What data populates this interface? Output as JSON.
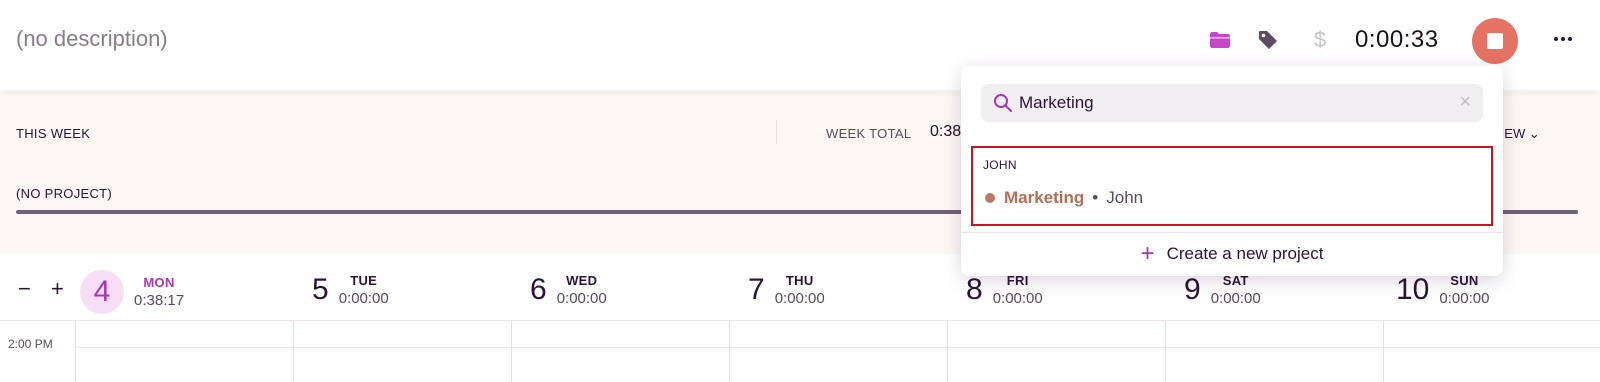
{
  "timer": {
    "description": "(no description)",
    "elapsed": "0:00:33",
    "icons": [
      "folder-icon",
      "tag-icon",
      "dollar-icon",
      "stop-icon",
      "more-icon"
    ],
    "colors": {
      "accent": "#a736b6",
      "stop": "#e57262",
      "folder": "#c548c9"
    }
  },
  "summary": {
    "this_week": "THIS WEEK",
    "week_total_label": "WEEK TOTAL",
    "week_total_value": "0:38",
    "view_label": "VIEW",
    "no_project": "(NO PROJECT)"
  },
  "calendar": {
    "zoom_out": "−",
    "zoom_in": "+",
    "days": [
      {
        "num": "4",
        "name": "MON",
        "time": "0:38:17",
        "today": true
      },
      {
        "num": "5",
        "name": "TUE",
        "time": "0:00:00"
      },
      {
        "num": "6",
        "name": "WED",
        "time": "0:00:00"
      },
      {
        "num": "7",
        "name": "THU",
        "time": "0:00:00"
      },
      {
        "num": "8",
        "name": "FRI",
        "time": "0:00:00"
      },
      {
        "num": "9",
        "name": "SAT",
        "time": "0:00:00"
      },
      {
        "num": "10",
        "name": "SUN",
        "time": "0:00:00"
      }
    ],
    "time_label": "2:00 PM"
  },
  "project_dropdown": {
    "search_value": "Marketing",
    "client": "JOHN",
    "project": {
      "name": "Marketing",
      "separator": "•",
      "client": "John",
      "color": "#b97a63"
    },
    "create_label": "Create a new project"
  }
}
